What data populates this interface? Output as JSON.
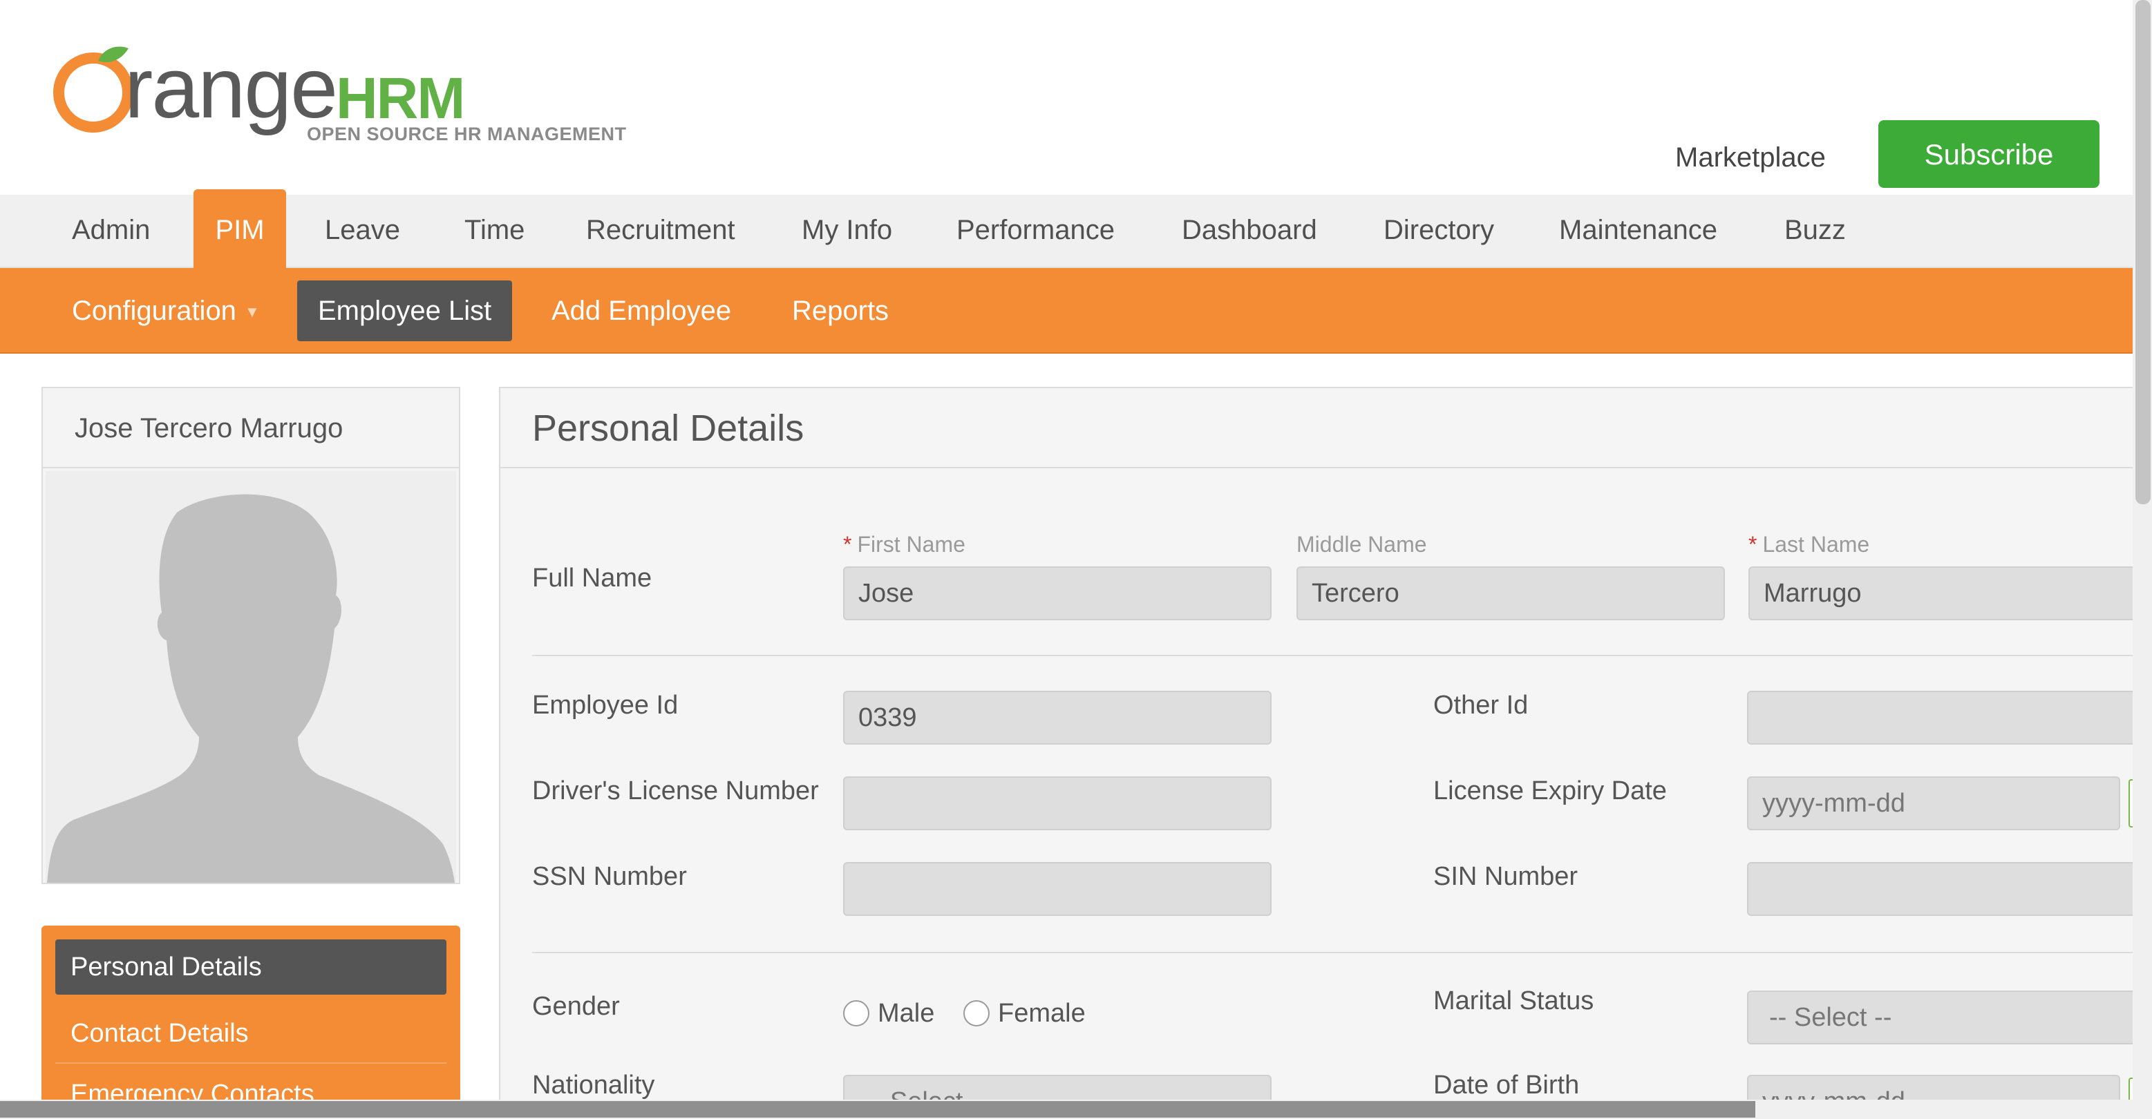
{
  "header": {
    "logo": {
      "word": "range",
      "hrm": "HRM",
      "tagline": "OPEN SOURCE HR MANAGEMENT"
    },
    "marketplace_label": "Marketplace",
    "subscribe_label": "Subscribe"
  },
  "main_nav": {
    "items": [
      "Admin",
      "PIM",
      "Leave",
      "Time",
      "Recruitment",
      "My Info",
      "Performance",
      "Dashboard",
      "Directory",
      "Maintenance",
      "Buzz"
    ],
    "active": "PIM"
  },
  "sub_nav": {
    "items": [
      "Configuration",
      "Employee List",
      "Add Employee",
      "Reports"
    ],
    "active": "Employee List"
  },
  "profile": {
    "name": "Jose Tercero Marrugo"
  },
  "side_menu": {
    "items": [
      "Personal Details",
      "Contact Details",
      "Emergency Contacts"
    ],
    "active": "Personal Details"
  },
  "personal_details": {
    "title": "Personal Details",
    "full_name_label": "Full Name",
    "first_name_label": "First Name",
    "middle_name_label": "Middle Name",
    "last_name_label": "Last Name",
    "required_mark": "*",
    "first_name": "Jose",
    "middle_name": "Tercero",
    "last_name": "Marrugo",
    "employee_id_label": "Employee Id",
    "employee_id": "0339",
    "other_id_label": "Other Id",
    "other_id": "",
    "drivers_license_label": "Driver's License Number",
    "drivers_license": "",
    "license_expiry_label": "License Expiry Date",
    "license_expiry_placeholder": "yyyy-mm-dd",
    "ssn_label": "SSN Number",
    "ssn": "",
    "sin_label": "SIN Number",
    "sin": "",
    "gender_label": "Gender",
    "gender_options": [
      "Male",
      "Female"
    ],
    "marital_status_label": "Marital Status",
    "marital_status_value": "-- Select --",
    "nationality_label": "Nationality",
    "nationality_value": "-- Select --",
    "dob_label": "Date of Birth",
    "dob_placeholder": "yyyy-mm-dd"
  },
  "colors": {
    "brand_orange": "#f48b35",
    "subscribe_green": "#3cab38",
    "active_dark": "#555555"
  }
}
